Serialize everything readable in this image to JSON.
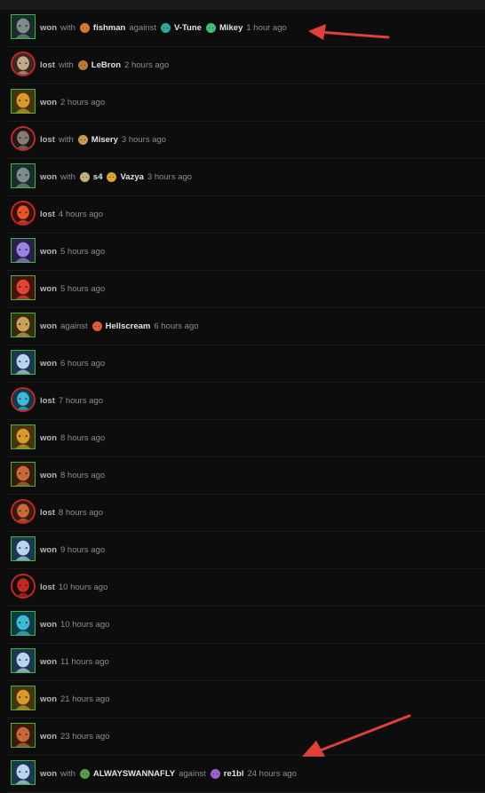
{
  "colors": {
    "won_border": "#3cb83c",
    "lost_border": "#c0282b",
    "arrow": "#e0403a"
  },
  "matches": [
    {
      "result": "won",
      "hero_icon": "hooded-assassin-hero-icon",
      "palette": [
        "#1b2a2a",
        "#7d8c8c"
      ],
      "with_label": "with",
      "teammates": [
        {
          "name": "fishman",
          "icon": "orange-beast-hero-icon",
          "color": "#d9772f"
        }
      ],
      "against_label": "against",
      "enemies": [
        {
          "name": "V-Tune",
          "icon": "teal-spider-hero-icon",
          "color": "#2fa89b"
        },
        {
          "name": "Mikey",
          "icon": "green-turtle-hero-icon",
          "color": "#3fbf7a"
        }
      ],
      "time": "1 hour ago"
    },
    {
      "result": "lost",
      "hero_icon": "skull-warrior-hero-icon",
      "palette": [
        "#3a2a22",
        "#c4a98a"
      ],
      "with_label": "with",
      "teammates": [
        {
          "name": "LeBron",
          "icon": "bull-hero-icon",
          "color": "#b97a3a"
        }
      ],
      "time": "2 hours ago"
    },
    {
      "result": "won",
      "hero_icon": "golden-insect-hero-icon",
      "palette": [
        "#4a3410",
        "#d99a2c"
      ],
      "time": "2 hours ago"
    },
    {
      "result": "lost",
      "hero_icon": "dark-demon-hero-icon",
      "palette": [
        "#201616",
        "#8a7a72"
      ],
      "with_label": "with",
      "teammates": [
        {
          "name": "Misery",
          "icon": "armored-knight-hero-icon",
          "color": "#c79a4f"
        }
      ],
      "time": "3 hours ago"
    },
    {
      "result": "won",
      "hero_icon": "hooded-assassin-hero-icon",
      "palette": [
        "#1b2a2a",
        "#7d8c8c"
      ],
      "with_label": "with",
      "teammates": [
        {
          "name": "s4",
          "icon": "round-shield-hero-icon",
          "color": "#c4b07a"
        },
        {
          "name": "Vazya",
          "icon": "golden-insect-hero-icon",
          "color": "#d9a13a"
        }
      ],
      "time": "3 hours ago"
    },
    {
      "result": "lost",
      "hero_icon": "flame-lord-hero-icon",
      "palette": [
        "#3a0f08",
        "#e2552a"
      ],
      "time": "4 hours ago"
    },
    {
      "result": "won",
      "hero_icon": "purple-mage-hero-icon",
      "palette": [
        "#2a1f4a",
        "#9b83e0"
      ],
      "time": "5 hours ago"
    },
    {
      "result": "won",
      "hero_icon": "red-brute-hero-icon",
      "palette": [
        "#4a0f0f",
        "#e0452f"
      ],
      "time": "5 hours ago"
    },
    {
      "result": "won",
      "hero_icon": "golden-warrior-hero-icon",
      "palette": [
        "#3a2a12",
        "#c9a25a"
      ],
      "against_label": "against",
      "enemies": [
        {
          "name": "Hellscream",
          "icon": "red-demon-hero-icon",
          "color": "#e05a3a"
        }
      ],
      "time": "6 hours ago"
    },
    {
      "result": "won",
      "hero_icon": "ice-maiden-hero-icon",
      "palette": [
        "#1f3550",
        "#b9d4ee"
      ],
      "time": "6 hours ago"
    },
    {
      "result": "lost",
      "hero_icon": "tidal-beast-hero-icon",
      "palette": [
        "#0f3a48",
        "#3fb9d6"
      ],
      "time": "7 hours ago"
    },
    {
      "result": "won",
      "hero_icon": "golden-insect-hero-icon",
      "palette": [
        "#4a3410",
        "#d99a2c"
      ],
      "time": "8 hours ago"
    },
    {
      "result": "won",
      "hero_icon": "bronze-mask-hero-icon",
      "palette": [
        "#3a1a0f",
        "#c76a38"
      ],
      "time": "8 hours ago"
    },
    {
      "result": "lost",
      "hero_icon": "bronze-mask-hero-icon",
      "palette": [
        "#3a1a0f",
        "#c76a38"
      ],
      "time": "8 hours ago"
    },
    {
      "result": "won",
      "hero_icon": "ice-maiden-hero-icon",
      "palette": [
        "#1f3550",
        "#b9d4ee"
      ],
      "time": "9 hours ago"
    },
    {
      "result": "lost",
      "hero_icon": "shadow-fiend-hero-icon",
      "palette": [
        "#1a0a0a",
        "#c22a22"
      ],
      "time": "10 hours ago"
    },
    {
      "result": "won",
      "hero_icon": "tidal-beast-hero-icon",
      "palette": [
        "#0f3a48",
        "#3fb9d6"
      ],
      "time": "10 hours ago"
    },
    {
      "result": "won",
      "hero_icon": "ice-maiden-hero-icon",
      "palette": [
        "#1f3550",
        "#b9d4ee"
      ],
      "time": "11 hours ago"
    },
    {
      "result": "won",
      "hero_icon": "golden-insect-hero-icon",
      "palette": [
        "#4a3410",
        "#d99a2c"
      ],
      "time": "21 hours ago"
    },
    {
      "result": "won",
      "hero_icon": "bronze-mask-hero-icon",
      "palette": [
        "#3a1a0f",
        "#c76a38"
      ],
      "time": "23 hours ago"
    },
    {
      "result": "won",
      "hero_icon": "ice-maiden-hero-icon",
      "palette": [
        "#1f3550",
        "#b9d4ee"
      ],
      "with_label": "with",
      "teammates": [
        {
          "name": "ALWAYSWANNAFLY",
          "icon": "green-orc-hero-icon",
          "color": "#5f9a4a"
        }
      ],
      "against_label": "against",
      "enemies": [
        {
          "name": "re1bl",
          "icon": "purple-demon-hero-icon",
          "color": "#9a5fd0"
        }
      ],
      "time": "24 hours ago"
    }
  ]
}
